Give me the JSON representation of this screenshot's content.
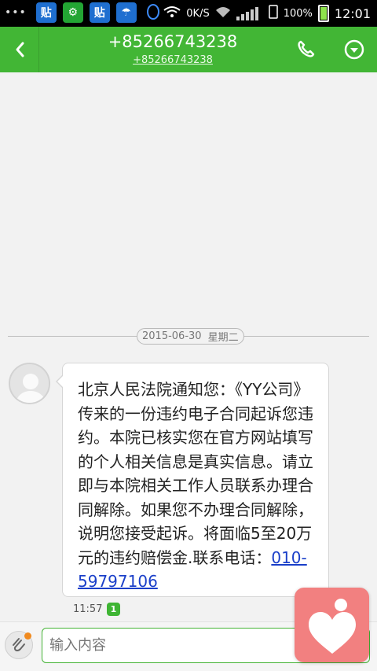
{
  "status_bar": {
    "network_label": "0K/S",
    "battery_percent": "100%",
    "time": "12:01",
    "app_icons": [
      {
        "name": "tieba-icon",
        "glyph": "贴"
      },
      {
        "name": "green-app-icon",
        "glyph": "⚙"
      },
      {
        "name": "tieba-icon-2",
        "glyph": "贴"
      },
      {
        "name": "weather-app-icon",
        "glyph": "☂"
      },
      {
        "name": "qq-icon",
        "glyph": "♟"
      }
    ]
  },
  "header": {
    "back_icon": "chevron-left-icon",
    "title": "+85266743238",
    "subtitle": "+85266743238",
    "call_icon": "phone-icon",
    "more_icon": "chevron-down-circle-icon"
  },
  "date_divider": {
    "date": "2015-06-30",
    "weekday": "星期二"
  },
  "message": {
    "text_before_link": "北京人民法院通知您：《YY公司》传来的一份违约电子合同起诉您违约。本院已核实您在官方网站填写的个人相关信息是真实信息。请立即与本院相关工作人员联系办理合同解除。如果您不办理合同解除，说明您接受起诉。将面临5至20万元的违约赔偿金.联系电话：",
    "phone_link": "010-59797106",
    "time": "11:57",
    "sim_badge": "1"
  },
  "composer": {
    "attach_icon": "paperclip-icon",
    "placeholder": "输入内容"
  },
  "overlay": {
    "icon": "heart-person-icon"
  },
  "colors": {
    "header_green": "#42b635",
    "link_blue": "#1a3fc9",
    "overlay_pink": "#f28080"
  }
}
